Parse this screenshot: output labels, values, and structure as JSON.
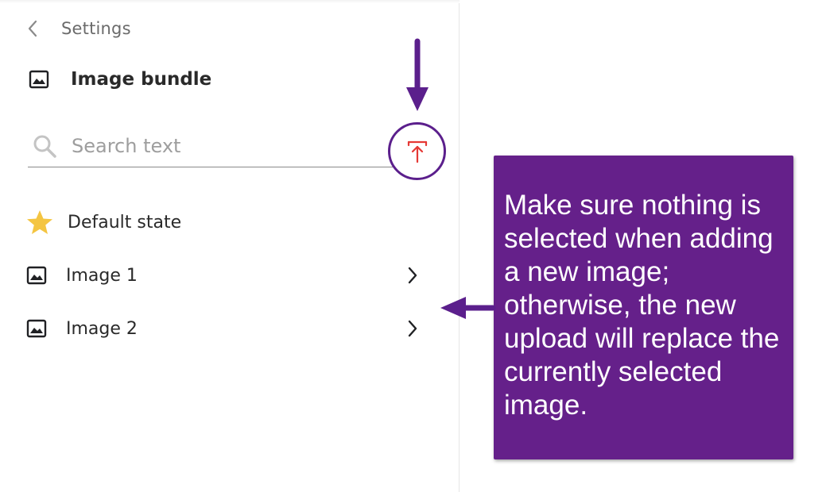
{
  "nav": {
    "back_label": "Settings"
  },
  "panel": {
    "title": "Image bundle"
  },
  "search": {
    "placeholder": "Search text",
    "value": ""
  },
  "list": {
    "items": [
      {
        "label": "Default state",
        "icon": "star-icon"
      },
      {
        "label": "Image 1",
        "icon": "image-icon"
      },
      {
        "label": "Image 2",
        "icon": "image-icon"
      }
    ]
  },
  "upload_button": {
    "icon": "upload-icon",
    "icon_color": "#e53935",
    "ring_color": "#5b1f8c"
  },
  "callout": {
    "text": "Make sure nothing is selected when adding a new image; otherwise, the new upload will replace the currently selected image.",
    "background": "#65208a",
    "text_color": "#ffffff"
  },
  "colors": {
    "accent_purple": "#5b1f8c",
    "star": "#f4c542"
  }
}
